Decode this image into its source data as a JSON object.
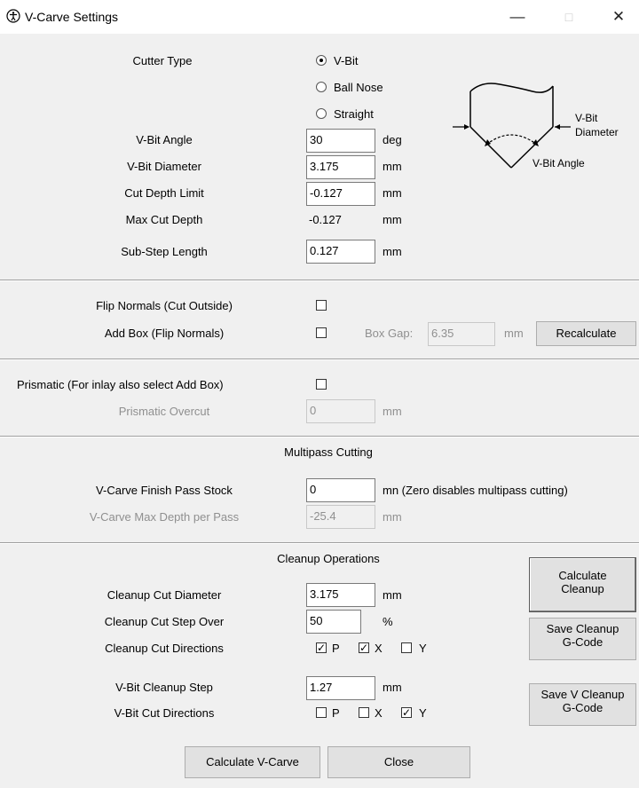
{
  "window": {
    "title": "V-Carve Settings",
    "minimize": "—",
    "maximize": "□",
    "close": "✕"
  },
  "cutter": {
    "label": "Cutter Type",
    "options": [
      {
        "label": "V-Bit",
        "selected": true
      },
      {
        "label": "Ball Nose",
        "selected": false
      },
      {
        "label": "Straight",
        "selected": false
      }
    ],
    "diagram": {
      "diameter_line1": "V-Bit",
      "diameter_line2": "Diameter",
      "angle": "V-Bit Angle"
    }
  },
  "params": {
    "vbit_angle": {
      "label": "V-Bit Angle",
      "value": "30",
      "unit": "deg"
    },
    "vbit_diameter": {
      "label": "V-Bit Diameter",
      "value": "3.175",
      "unit": "mm"
    },
    "cut_depth_limit": {
      "label": "Cut Depth Limit",
      "value": "-0.127",
      "unit": "mm"
    },
    "max_cut_depth": {
      "label": "Max Cut Depth",
      "value": "-0.127",
      "unit": "mm"
    },
    "sub_step_length": {
      "label": "Sub-Step Length",
      "value": "0.127",
      "unit": "mm"
    }
  },
  "flip": {
    "flip_normals": {
      "label": "Flip Normals (Cut Outside)",
      "checked": false
    },
    "add_box": {
      "label": "Add Box (Flip Normals)",
      "checked": false
    },
    "box_gap": {
      "label": "Box Gap:",
      "value": "6.35",
      "unit": "mm"
    },
    "recalculate": "Recalculate"
  },
  "prismatic": {
    "label": "Prismatic (For inlay also select Add Box)",
    "checked": false,
    "overcut": {
      "label": "Prismatic Overcut",
      "value": "0",
      "unit": "mm"
    }
  },
  "multipass": {
    "heading": "Multipass Cutting",
    "finish_stock": {
      "label": "V-Carve Finish Pass Stock",
      "value": "0",
      "unit": "mn (Zero disables multipass cutting)"
    },
    "max_depth": {
      "label": "V-Carve Max Depth per Pass",
      "value": "-25.4",
      "unit": "mm"
    }
  },
  "cleanup": {
    "heading": "Cleanup Operations",
    "diameter": {
      "label": "Cleanup Cut Diameter",
      "value": "3.175",
      "unit": "mm"
    },
    "step_over": {
      "label": "Cleanup Cut Step Over",
      "value": "50",
      "unit": "%"
    },
    "directions": {
      "label": "Cleanup Cut Directions",
      "p": "P",
      "x": "X",
      "y": "Y",
      "p_checked": true,
      "x_checked": true,
      "y_checked": false
    },
    "vbit_step": {
      "label": "V-Bit Cleanup Step",
      "value": "1.27",
      "unit": "mm"
    },
    "vbit_directions": {
      "label": "V-Bit Cut Directions",
      "p": "P",
      "x": "X",
      "y": "Y",
      "p_checked": false,
      "x_checked": false,
      "y_checked": true
    },
    "calc_button": {
      "line1": "Calculate",
      "line2": "Cleanup"
    },
    "save_button": {
      "line1": "Save Cleanup",
      "line2": "G-Code"
    },
    "save_v_button": {
      "line1": "Save V Cleanup",
      "line2": "G-Code"
    }
  },
  "footer": {
    "calculate": "Calculate V-Carve",
    "close": "Close"
  }
}
